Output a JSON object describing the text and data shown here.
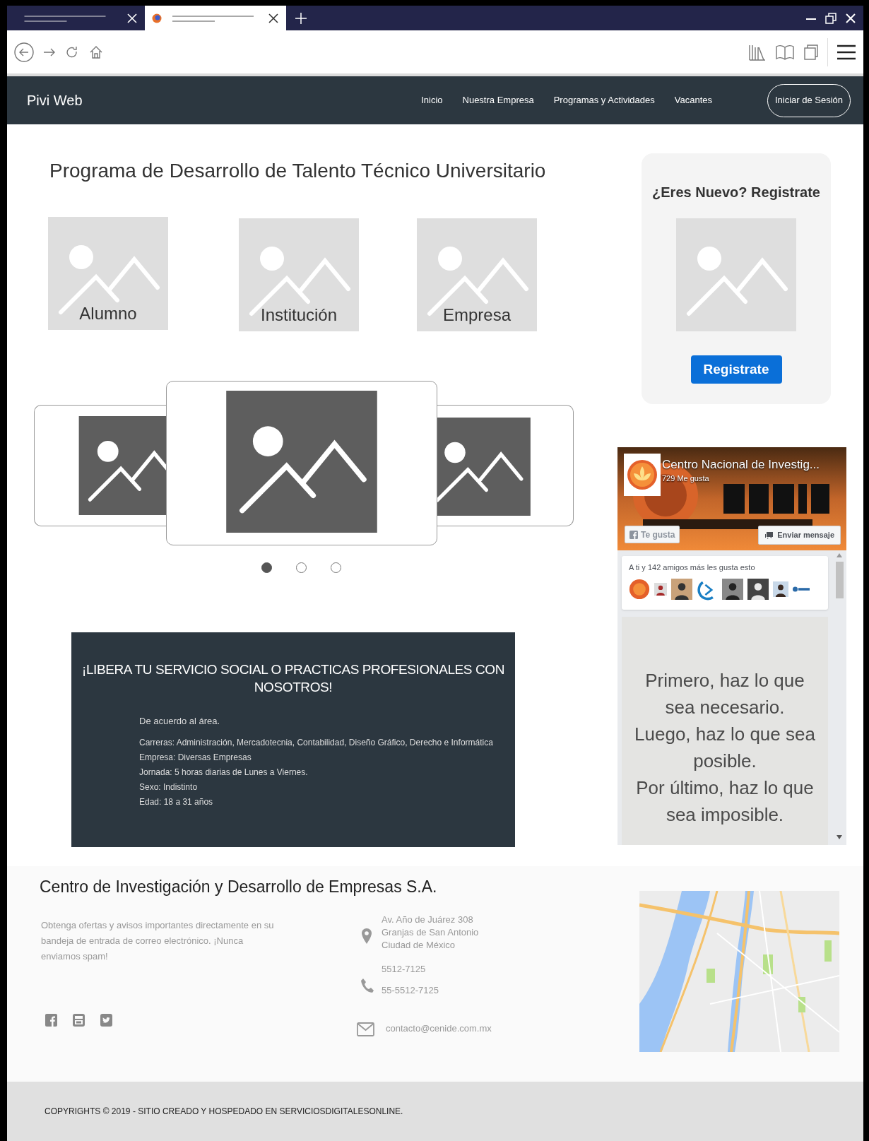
{
  "browser_tabs": [
    {
      "selected": false
    },
    {
      "selected": true
    }
  ],
  "navbar": {
    "brand": "Pivi Web",
    "links": [
      "Inicio",
      "Nuestra Empresa",
      "Programas y Actividades",
      "Vacantes"
    ],
    "login_button": "Iniciar de Sesión"
  },
  "program": {
    "title": "Programa de Desarrollo de Talento Técnico Universitario",
    "categories": [
      {
        "label": "Alumno"
      },
      {
        "label": "Institución"
      },
      {
        "label": "Empresa"
      }
    ],
    "carousel_dots": [
      {
        "selected": true
      },
      {
        "selected": false
      },
      {
        "selected": false
      }
    ]
  },
  "info_box": {
    "heading": "¡LIBERA TU SERVICIO SOCIAL O PRACTICAS PROFESIONALES CON NOSOTROS!",
    "intro": "De acuerdo al área.",
    "lines": [
      "Carreras: Administración, Mercadotecnia, Contabilidad, Diseño Gráfico, Derecho e Informática",
      "Empresa: Diversas Empresas",
      "Jornada: 5 horas diarias de Lunes a Viernes.",
      "Sexo: Indistinto",
      "Edad: 18 a 31 años"
    ]
  },
  "register_card": {
    "title": "¿Eres Nuevo? Registrate",
    "button": "Registrate"
  },
  "facebook_widget": {
    "page_name": "Centro Nacional de Investig...",
    "likes": "729 Me gusta",
    "like_button": "Te gusta",
    "message_button": "Enviar mensaje",
    "friends_text": "A ti y 142 amigos más les gusta esto",
    "post_quote": "Primero, haz lo que\nsea necesario.\nLuego, haz lo que sea\nposible.\nPor último, haz lo que\nsea imposible."
  },
  "footer": {
    "company": "Centro de Investigación y Desarrollo de Empresas S.A.",
    "newsletter": "Obtenga ofertas y avisos importantes directamente en su bandeja de entrada de correo electrónico. ¡Nunca enviamos spam!",
    "address": [
      "Av. Año de Juárez 308",
      "Granjas de San Antonio",
      "Ciudad de México"
    ],
    "phones": [
      "5512-7125",
      "55-5512-7125"
    ],
    "email": "contacto@cenide.com.mx",
    "copyright": "COPYRIGHTS © 2019 - SITIO CREADO Y HOSPEDADO EN SERVICIOSDIGITALESONLINE."
  }
}
